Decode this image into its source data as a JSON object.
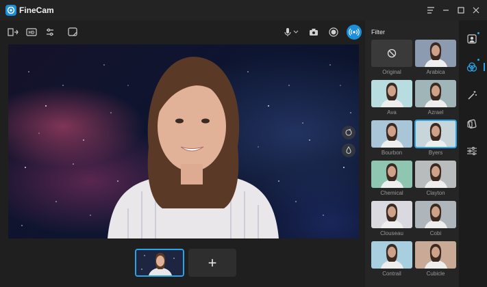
{
  "app": {
    "title": "FineCam"
  },
  "filter": {
    "title": "Filter",
    "items": [
      {
        "label": "Original",
        "tone": "#3a3a3a",
        "selected": false
      },
      {
        "label": "Arabica",
        "tone": "#8c9bb0",
        "selected": false
      },
      {
        "label": "Ava",
        "tone": "#b7dde0",
        "selected": false
      },
      {
        "label": "Azrael",
        "tone": "#9fb5b8",
        "selected": false
      },
      {
        "label": "Bourbon",
        "tone": "#a9c6d8",
        "selected": false
      },
      {
        "label": "Byers",
        "tone": "#c8d6da",
        "selected": true
      },
      {
        "label": "Chemical",
        "tone": "#8fc6b2",
        "selected": false
      },
      {
        "label": "Clayton",
        "tone": "#b9bcbd",
        "selected": false
      },
      {
        "label": "Clouseau",
        "tone": "#d9d9df",
        "selected": false
      },
      {
        "label": "Cobi",
        "tone": "#aeb6bb",
        "selected": false
      },
      {
        "label": "Contrail",
        "tone": "#a8cfe0",
        "selected": false
      },
      {
        "label": "Cubicle",
        "tone": "#c9aa96",
        "selected": false
      }
    ]
  },
  "colors": {
    "accent": "#2aa5e8",
    "background": "#1f1f1f",
    "panel": "#252525"
  },
  "thumbs": {
    "add_label": "+"
  }
}
